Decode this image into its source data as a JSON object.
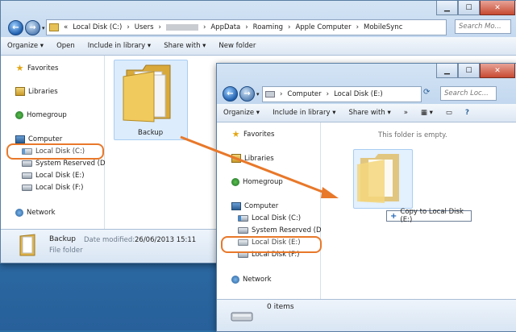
{
  "back_window": {
    "address": [
      "«",
      "Local Disk (C:)",
      "Users",
      "AppData",
      "Roaming",
      "Apple Computer",
      "MobileSync"
    ],
    "search_placeholder": "Search Mo...",
    "toolbar": {
      "organize": "Organize ▾",
      "open": "Open",
      "include": "Include in library ▾",
      "share": "Share with ▾",
      "new_folder": "New folder"
    },
    "nav": {
      "favorites": "Favorites",
      "libraries": "Libraries",
      "homegroup": "Homegroup",
      "computer": "Computer",
      "drive_c": "Local Disk (C:)",
      "drive_sys": "System Reserved (D:)",
      "drive_e": "Local Disk (E:)",
      "drive_f": "Local Disk (F:)",
      "network": "Network"
    },
    "folder_label": "Backup",
    "status": {
      "name": "Backup",
      "modified_label": "Date modified:",
      "modified": "26/06/2013 15:11",
      "type": "File folder"
    }
  },
  "front_window": {
    "address": [
      "Computer",
      "Local Disk (E:)"
    ],
    "search_placeholder": "Search Loc...",
    "toolbar": {
      "organize": "Organize ▾",
      "include": "Include in library ▾",
      "share": "Share with ▾",
      "more": "»"
    },
    "empty_message": "This folder is empty.",
    "nav": {
      "favorites": "Favorites",
      "libraries": "Libraries",
      "homegroup": "Homegroup",
      "computer": "Computer",
      "drive_c": "Local Disk (C:)",
      "drive_sys": "System Reserved (D:)",
      "drive_e": "Local Disk (E:)",
      "drive_f": "Local Disk (F:)",
      "network": "Network"
    },
    "copy_tooltip": "Copy to Local Disk (E:)",
    "status_items": "0 items"
  },
  "colors": {
    "highlight": "#e8782a",
    "arrow": "#e8782a"
  }
}
